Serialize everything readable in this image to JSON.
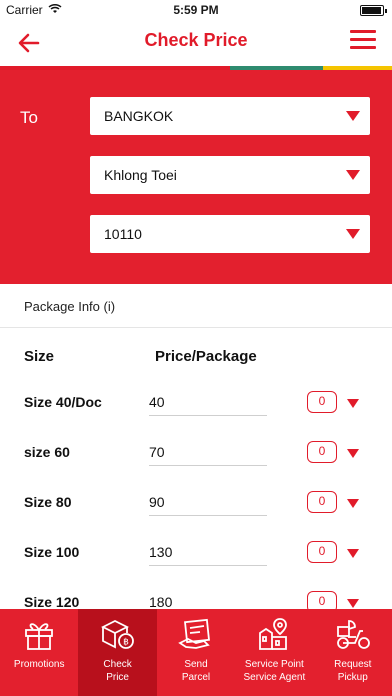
{
  "status_bar": {
    "carrier": "Carrier",
    "time": "5:59 PM"
  },
  "header": {
    "title": "Check Price"
  },
  "destination": {
    "to_label": "To",
    "province": "BANGKOK",
    "district": "Khlong Toei",
    "postcode": "10110"
  },
  "package": {
    "info_label": "Package Info (i)",
    "col_size": "Size",
    "col_price": "Price/Package",
    "rows": [
      {
        "size": "Size 40/Doc",
        "price": "40",
        "qty": "0"
      },
      {
        "size": "size 60",
        "price": "70",
        "qty": "0"
      },
      {
        "size": "Size 80",
        "price": "90",
        "qty": "0"
      },
      {
        "size": "Size 100",
        "price": "130",
        "qty": "0"
      },
      {
        "size": "Size 120",
        "price": "180",
        "qty": "0"
      }
    ]
  },
  "tabbar": {
    "items": [
      {
        "label1": "Promotions",
        "label2": "",
        "icon": "gift-icon"
      },
      {
        "label1": "Check",
        "label2": "Price",
        "icon": "box-price-icon"
      },
      {
        "label1": "Send",
        "label2": "Parcel",
        "icon": "send-parcel-icon"
      },
      {
        "label1": "Service Point",
        "label2": "Service Agent",
        "icon": "service-point-icon"
      },
      {
        "label1": "Request",
        "label2": "Pickup",
        "icon": "scooter-icon"
      }
    ],
    "active_index": 1
  },
  "colors": {
    "brand_red": "#e11b2a",
    "green": "#2e8b6f",
    "yellow": "#f5c400"
  }
}
